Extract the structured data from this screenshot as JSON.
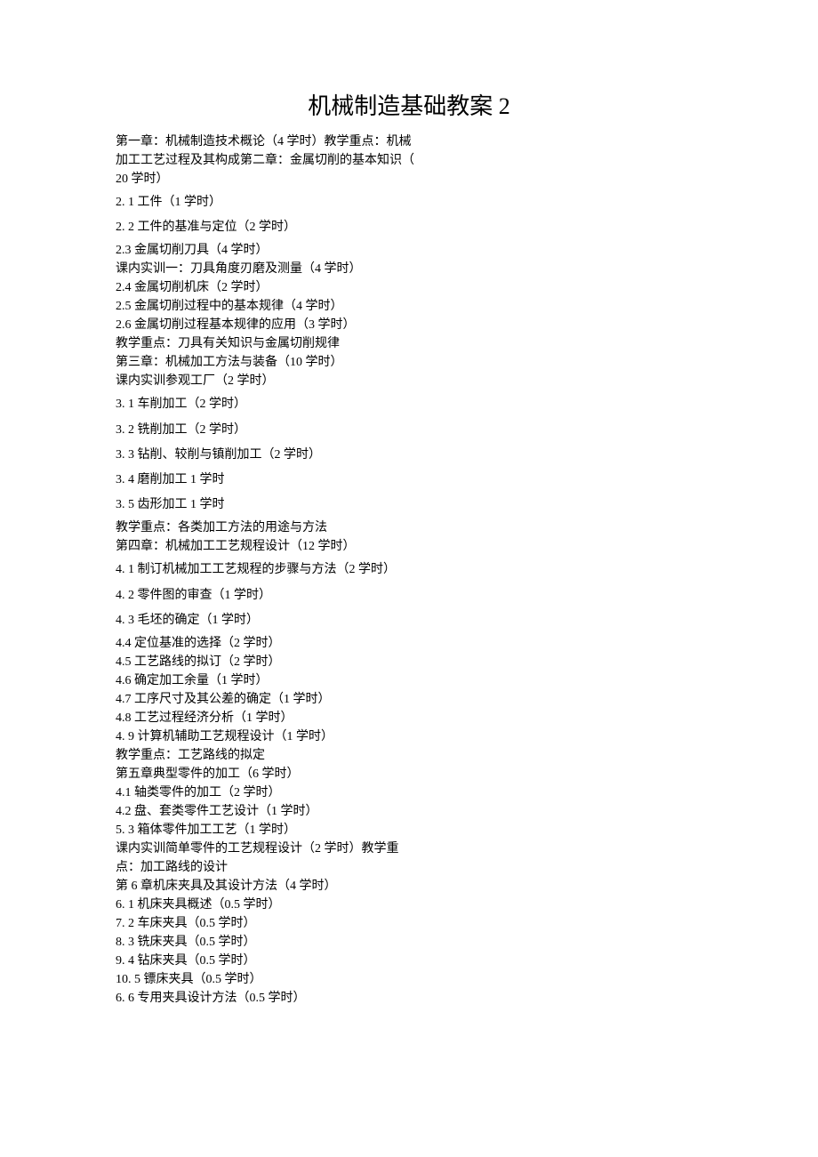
{
  "title": "机械制造基础教案 2",
  "lines": [
    "第一章：机械制造技术概论（4 学时）教学重点：机械",
    "加工工艺过程及其构成第二章：金属切削的基本知识（",
    "20 学时）",
    "2.  1 工件（1 学时）",
    "2.  2 工件的基准与定位（2 学时）",
    "2.3    金属切削刀具（4 学时）",
    "课内实训一：刀具角度刃磨及测量（4 学时）",
    "2.4    金属切削机床（2 学时）",
    "2.5    金属切削过程中的基本规律（4 学时）",
    "2.6    金属切削过程基本规律的应用（3 学时）",
    "教学重点：刀具有关知识与金属切削规律",
    "第三章：机械加工方法与装备（10 学时）",
    "课内实训参观工厂（2 学时）",
    "3.  1 车削加工（2 学时）",
    "3.  2 铣削加工（2 学时）",
    "3.  3 钻削、较削与镇削加工（2 学时）",
    "3.  4 磨削加工 1 学时",
    "3.  5 齿形加工 1 学时",
    "教学重点：各类加工方法的用途与方法",
    "第四章：机械加工工艺规程设计（12 学时）",
    "4.  1 制订机械加工工艺规程的步骤与方法（2 学时）",
    "4.  2 零件图的审查（1 学时）",
    "4.  3 毛坯的确定（1 学时）",
    "4.4 定位基准的选择（2 学时）",
    "4.5 工艺路线的拟订（2 学时）",
    "4.6 确定加工余量（1 学时）",
    "4.7 工序尺寸及其公差的确定（1 学时）",
    "4.8 工艺过程经济分析（1 学时）",
    "4.  9 计算机辅助工艺规程设计（1 学时）",
    "教学重点：工艺路线的拟定",
    "第五章典型零件的加工（6 学时）",
    "4.1    轴类零件的加工（2 学时）",
    "4.2    盘、套类零件工艺设计（1 学时）",
    "5.  3 箱体零件加工工艺（1 学时）",
    "课内实训简单零件的工艺规程设计（2 学时）教学重",
    "点：加工路线的设计",
    "第 6 章机床夹具及其设计方法（4 学时）",
    "6.  1 机床夹具概述（0.5 学时）",
    "7.  2 车床夹具（0.5 学时）",
    "8.  3 铣床夹具（0.5 学时）",
    "9.  4 钻床夹具（0.5 学时）",
    "10. 5 镖床夹具（0.5 学时）",
    "6.  6 专用夹具设计方法（0.5 学时）"
  ]
}
